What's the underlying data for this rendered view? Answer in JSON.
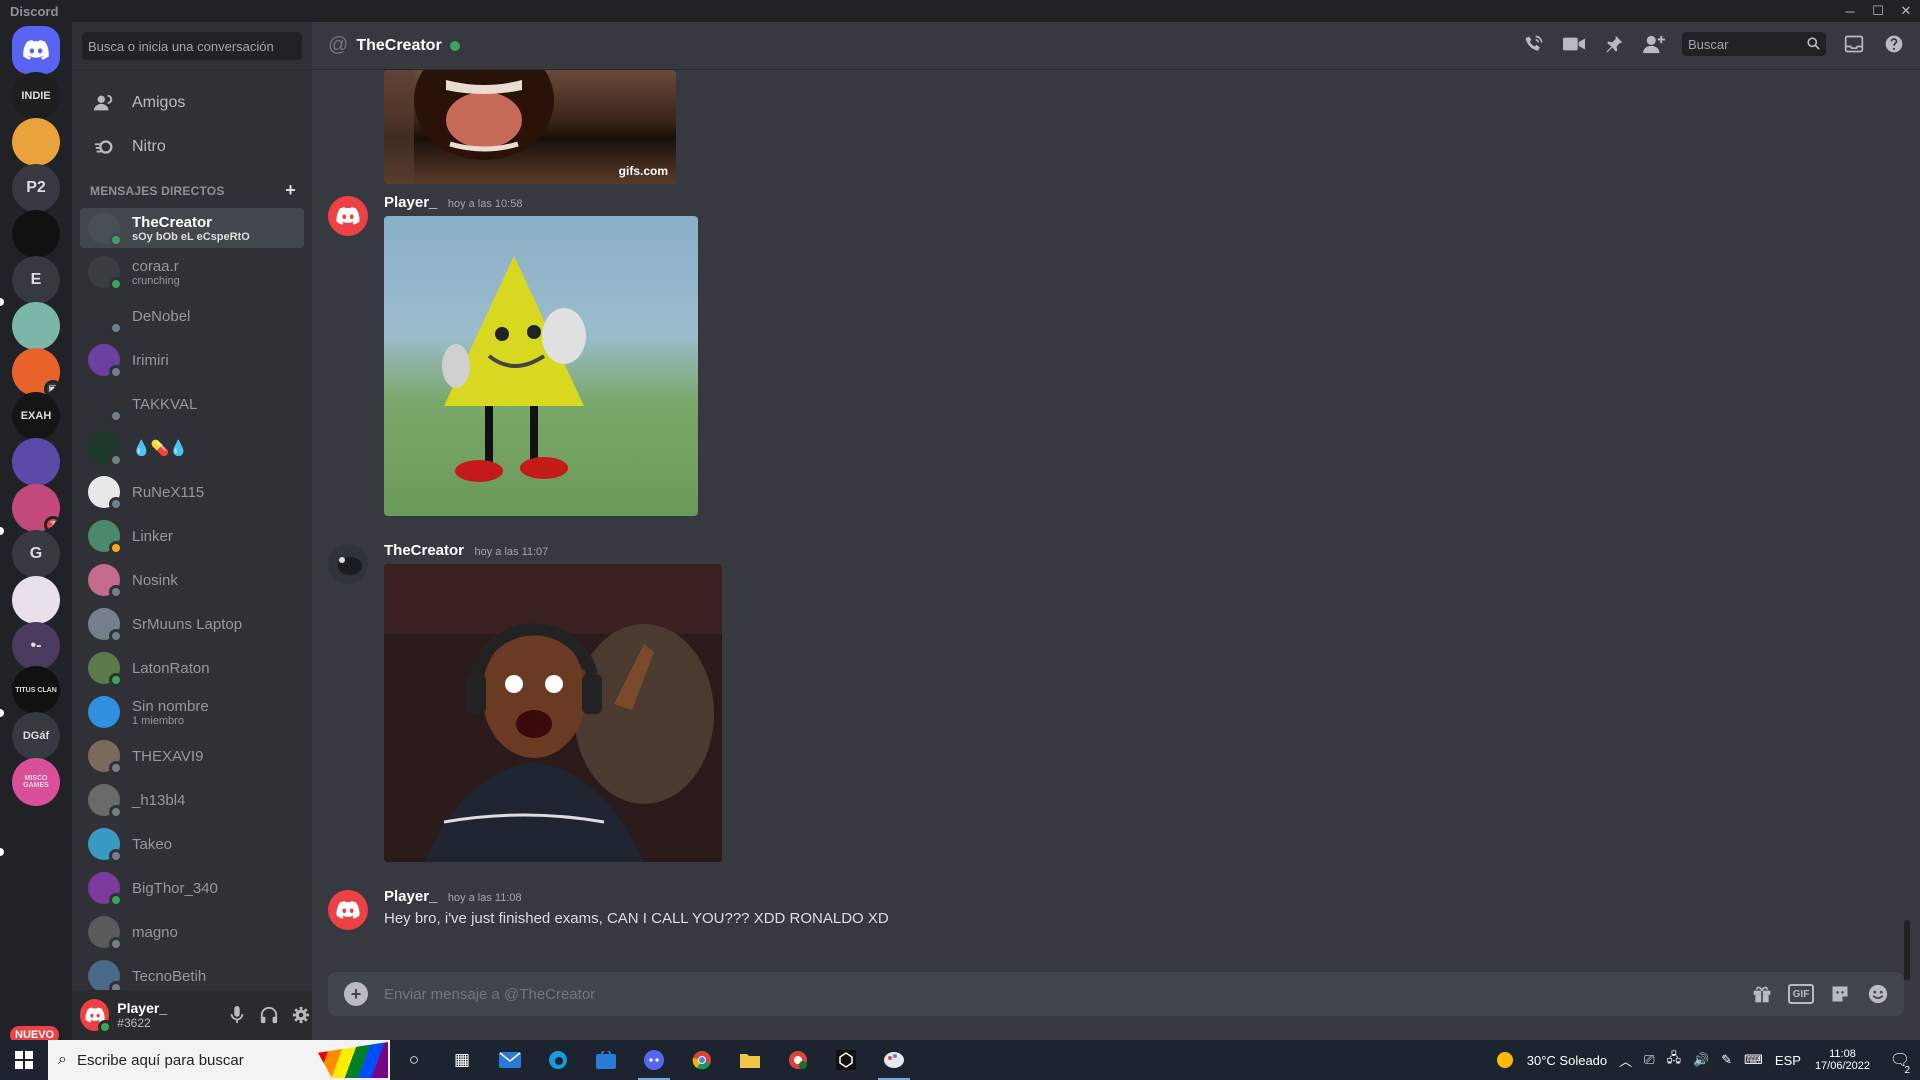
{
  "app": {
    "title": "Discord"
  },
  "window_controls": {
    "minimize": "─",
    "maximize": "☐",
    "close": "✕"
  },
  "servers": [
    {
      "label": "",
      "kind": "home",
      "color": "#5865f2"
    },
    {
      "label": "INDIE",
      "color": "#1e1e1e"
    },
    {
      "label": "",
      "color": "#e8a33a"
    },
    {
      "label": "P2",
      "color": "#36393f"
    },
    {
      "label": "",
      "color": "#111111"
    },
    {
      "label": "E",
      "color": "#36393f"
    },
    {
      "label": "",
      "color": "#7ab7a8"
    },
    {
      "label": "",
      "color": "#e8632a",
      "badge_icon": "▣"
    },
    {
      "label": "EXAH",
      "color": "#151515"
    },
    {
      "label": "",
      "color": "#5b4aa8"
    },
    {
      "label": "",
      "color": "#c24a7a",
      "badge": "3"
    },
    {
      "label": "G",
      "color": "#36393f"
    },
    {
      "label": "",
      "color": "#e8e0ea"
    },
    {
      "label": "•-",
      "color": "#4a3a5e"
    },
    {
      "label": "TITUS CLAN",
      "color": "#111111"
    },
    {
      "label": "DGáf",
      "color": "#36393f"
    },
    {
      "label": "MISCO GAMES",
      "color": "#d94f9a"
    }
  ],
  "rail_badge": "NUEVO",
  "sidebar": {
    "search_placeholder": "Busca o inicia una conversación",
    "nav": [
      {
        "label": "Amigos",
        "icon": "friends-icon"
      },
      {
        "label": "Nitro",
        "icon": "nitro-icon"
      }
    ],
    "dm_header": "MENSAJES DIRECTOS",
    "dms": [
      {
        "name": "TheCreator",
        "sub": "sOy bOb eL eCspeRtO",
        "status": "online",
        "color": "#4a4f55",
        "active": true
      },
      {
        "name": "coraa.r",
        "sub": "crunching",
        "status": "online",
        "color": "#3a3d42"
      },
      {
        "name": "DeNobel",
        "sub": "",
        "status": "offline",
        "color": "#2f3136"
      },
      {
        "name": "Irimiri",
        "sub": "",
        "status": "offline",
        "color": "#6a3fa0"
      },
      {
        "name": "TAKKVAL",
        "sub": "",
        "status": "offline",
        "color": "#2f3136"
      },
      {
        "name": "💧💊💧",
        "sub": "",
        "status": "offline",
        "color": "#1d3a2a"
      },
      {
        "name": "RuNeX115",
        "sub": "",
        "status": "offline",
        "color": "#e8e8e8"
      },
      {
        "name": "Linker",
        "sub": "",
        "status": "idle",
        "color": "#4a8a6a"
      },
      {
        "name": "Nosink",
        "sub": "",
        "status": "offline",
        "color": "#c46a8a"
      },
      {
        "name": "SrMuuns Laptop",
        "sub": "",
        "status": "offline",
        "color": "#747f8d"
      },
      {
        "name": "LatonRaton",
        "sub": "",
        "status": "online",
        "color": "#5a7a4a"
      },
      {
        "name": "Sin nombre",
        "sub": "1 miembro",
        "status": "none",
        "color": "#2f8fe0"
      },
      {
        "name": "THEXAVI9",
        "sub": "",
        "status": "offline",
        "color": "#7a6a5a"
      },
      {
        "name": "_h13bl4",
        "sub": "",
        "status": "offline",
        "color": "#6a6a6a"
      },
      {
        "name": "Takeo",
        "sub": "",
        "status": "offline",
        "color": "#3a9ac4"
      },
      {
        "name": "BigThor_340",
        "sub": "",
        "status": "online",
        "color": "#7a3aa0"
      },
      {
        "name": "magno",
        "sub": "",
        "status": "offline",
        "color": "#5a5a5a"
      },
      {
        "name": "TecnoBetih",
        "sub": "",
        "status": "offline",
        "color": "#4a6a8a"
      }
    ]
  },
  "user": {
    "name": "Player_",
    "tag": "#3622"
  },
  "header": {
    "channel": "TheCreator",
    "search_placeholder": "Buscar"
  },
  "messages": [
    {
      "author": "Player_",
      "time": "hoy a las 10:58",
      "attachment": "gif-dancing-triangle",
      "avatar_color": "#ed4245"
    },
    {
      "author": "TheCreator",
      "time": "hoy a las 11:07",
      "attachment": "image-screaming-streamer",
      "avatar_color": "#4a4f55"
    },
    {
      "author": "Player_",
      "time": "hoy a las 11:08",
      "text": "Hey bro, i've just finished exams, CAN I CALL YOU??? XDD RONALDO XD",
      "avatar_color": "#ed4245"
    }
  ],
  "top_attachment": {
    "watermark": "gifs.com"
  },
  "composer": {
    "placeholder": "Enviar mensaje a @TheCreator",
    "gif_label": "GIF"
  },
  "taskbar": {
    "search_placeholder": "Escribe aquí para buscar",
    "weather": "30°C  Soleado",
    "lang": "ESP",
    "time": "11:08",
    "date": "17/06/2022",
    "notifications": "2"
  }
}
